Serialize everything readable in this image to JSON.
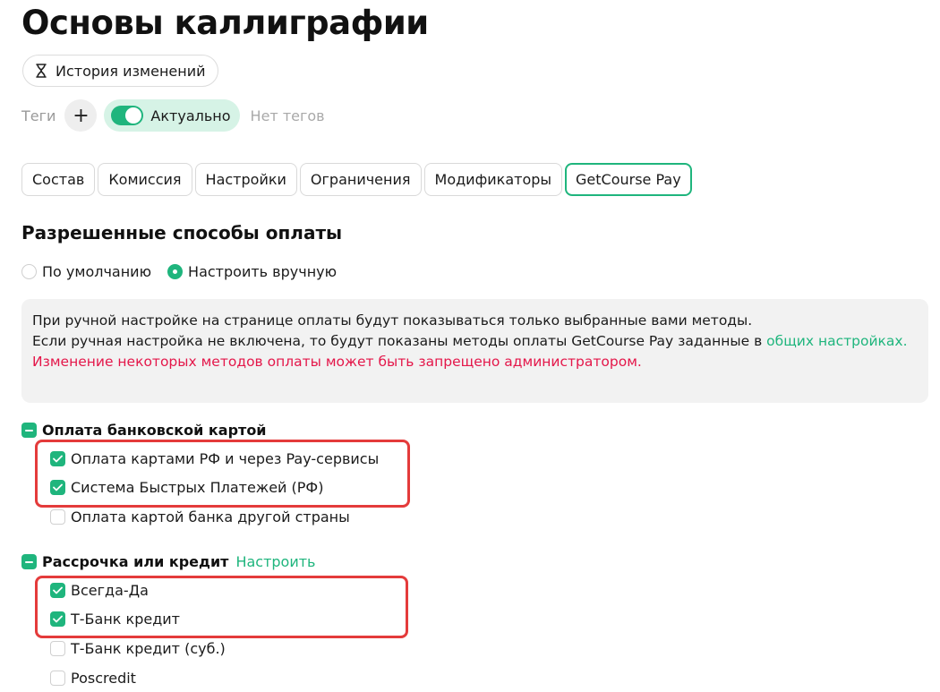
{
  "page": {
    "title": "Основы каллиграфии"
  },
  "history_button": {
    "label": "История изменений",
    "icon": "hourglass-icon"
  },
  "tags": {
    "label": "Теги",
    "add_icon": "+",
    "status_label": "Актуально",
    "status_on": true,
    "empty_label": "Нет тегов"
  },
  "tabs": [
    {
      "label": "Состав",
      "active": false
    },
    {
      "label": "Комиссия",
      "active": false
    },
    {
      "label": "Настройки",
      "active": false
    },
    {
      "label": "Ограничения",
      "active": false
    },
    {
      "label": "Модификаторы",
      "active": false
    },
    {
      "label": "GetCourse Pay",
      "active": true
    }
  ],
  "payment_methods": {
    "title": "Разрешенные способы оплаты",
    "mode_options": [
      {
        "label": "По умолчанию",
        "selected": false
      },
      {
        "label": "Настроить вручную",
        "selected": true
      }
    ],
    "info": {
      "line1": "При ручной настройке на странице оплаты будут показываться только выбранные вами методы.",
      "line2_prefix": "Если ручная настройка не включена, то будут показаны методы оплаты GetCourse Pay заданные в ",
      "line2_link": "общих настройках.",
      "warning": "Изменение некоторых методов оплаты может быть запрещено администратором."
    },
    "groups": [
      {
        "title": "Оплата банковской картой",
        "options": [
          {
            "label": "Оплата картами РФ и через Pay-сервисы",
            "checked": true
          },
          {
            "label": "Система Быстрых Платежей (РФ)",
            "checked": true
          },
          {
            "label": "Оплата картой банка другой страны",
            "checked": false
          }
        ]
      },
      {
        "title": "Рассрочка или кредит",
        "setup_link": "Настроить",
        "options": [
          {
            "label": "Всегда-Да",
            "checked": true
          },
          {
            "label": "Т-Банк кредит",
            "checked": true
          },
          {
            "label": "Т-Банк кредит (суб.)",
            "checked": false
          },
          {
            "label": "Poscredit",
            "checked": false
          }
        ]
      }
    ]
  },
  "colors": {
    "accent": "#1fb57d",
    "warning": "#e4174a",
    "highlight": "#e43b3b",
    "info_bg": "#f2f2f2"
  }
}
